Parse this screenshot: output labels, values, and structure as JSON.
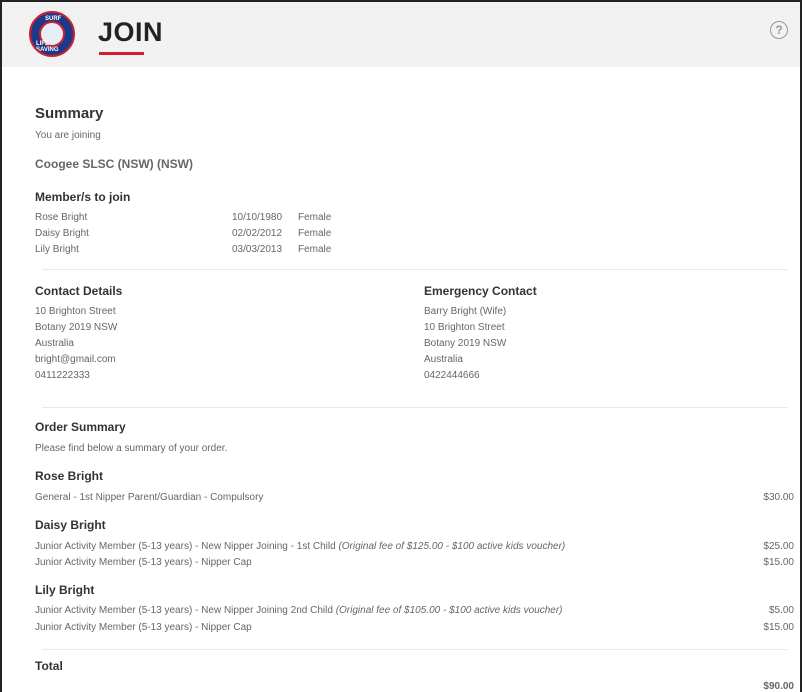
{
  "header": {
    "title": "JOIN",
    "logo_text_top": "SURF",
    "logo_text_bottom": "LIFE SAVING",
    "help_icon": "question-circle-icon",
    "accent": "#d21f2b"
  },
  "summary": {
    "title": "Summary",
    "joining_label": "You are joining",
    "club": "Coogee SLSC (NSW) (NSW)"
  },
  "members": {
    "title": "Member/s to join",
    "rows": [
      {
        "name": "Rose Bright",
        "dob": "10/10/1980",
        "gender": "Female"
      },
      {
        "name": "Daisy Bright",
        "dob": "02/02/2012",
        "gender": "Female"
      },
      {
        "name": "Lily Bright",
        "dob": "03/03/2013",
        "gender": "Female"
      }
    ]
  },
  "contact": {
    "title": "Contact Details",
    "lines": [
      "10 Brighton Street",
      "Botany 2019 NSW",
      "Australia",
      "bright@gmail.com",
      "0411222333"
    ]
  },
  "emergency": {
    "title": "Emergency Contact",
    "lines": [
      "Barry Bright (Wife)",
      "10 Brighton Street",
      "Botany 2019 NSW",
      "Australia",
      "0422444666"
    ]
  },
  "order": {
    "title": "Order Summary",
    "subtitle": "Please find below a summary of your order.",
    "groups": [
      {
        "name": "Rose Bright",
        "items": [
          {
            "desc": "General - 1st Nipper Parent/Guardian - Compulsory",
            "note": "",
            "price": "$30.00"
          }
        ]
      },
      {
        "name": "Daisy Bright",
        "items": [
          {
            "desc": "Junior Activity Member (5-13 years) - New Nipper Joining - 1st Child ",
            "note": "(Original fee of $125.00 - $100 active kids voucher)",
            "price": "$25.00"
          },
          {
            "desc": "Junior Activity Member (5-13 years) - Nipper Cap",
            "note": "",
            "price": "$15.00"
          }
        ]
      },
      {
        "name": "Lily Bright",
        "items": [
          {
            "desc": "Junior Activity Member (5-13 years) - New Nipper Joining 2nd Child ",
            "note": "(Original fee of $105.00 - $100 active kids voucher)",
            "price": "$5.00"
          },
          {
            "desc": "Junior Activity Member (5-13 years) - Nipper Cap",
            "note": "",
            "price": "$15.00"
          }
        ]
      }
    ],
    "total_label": "Total",
    "total_value": "$90.00"
  }
}
